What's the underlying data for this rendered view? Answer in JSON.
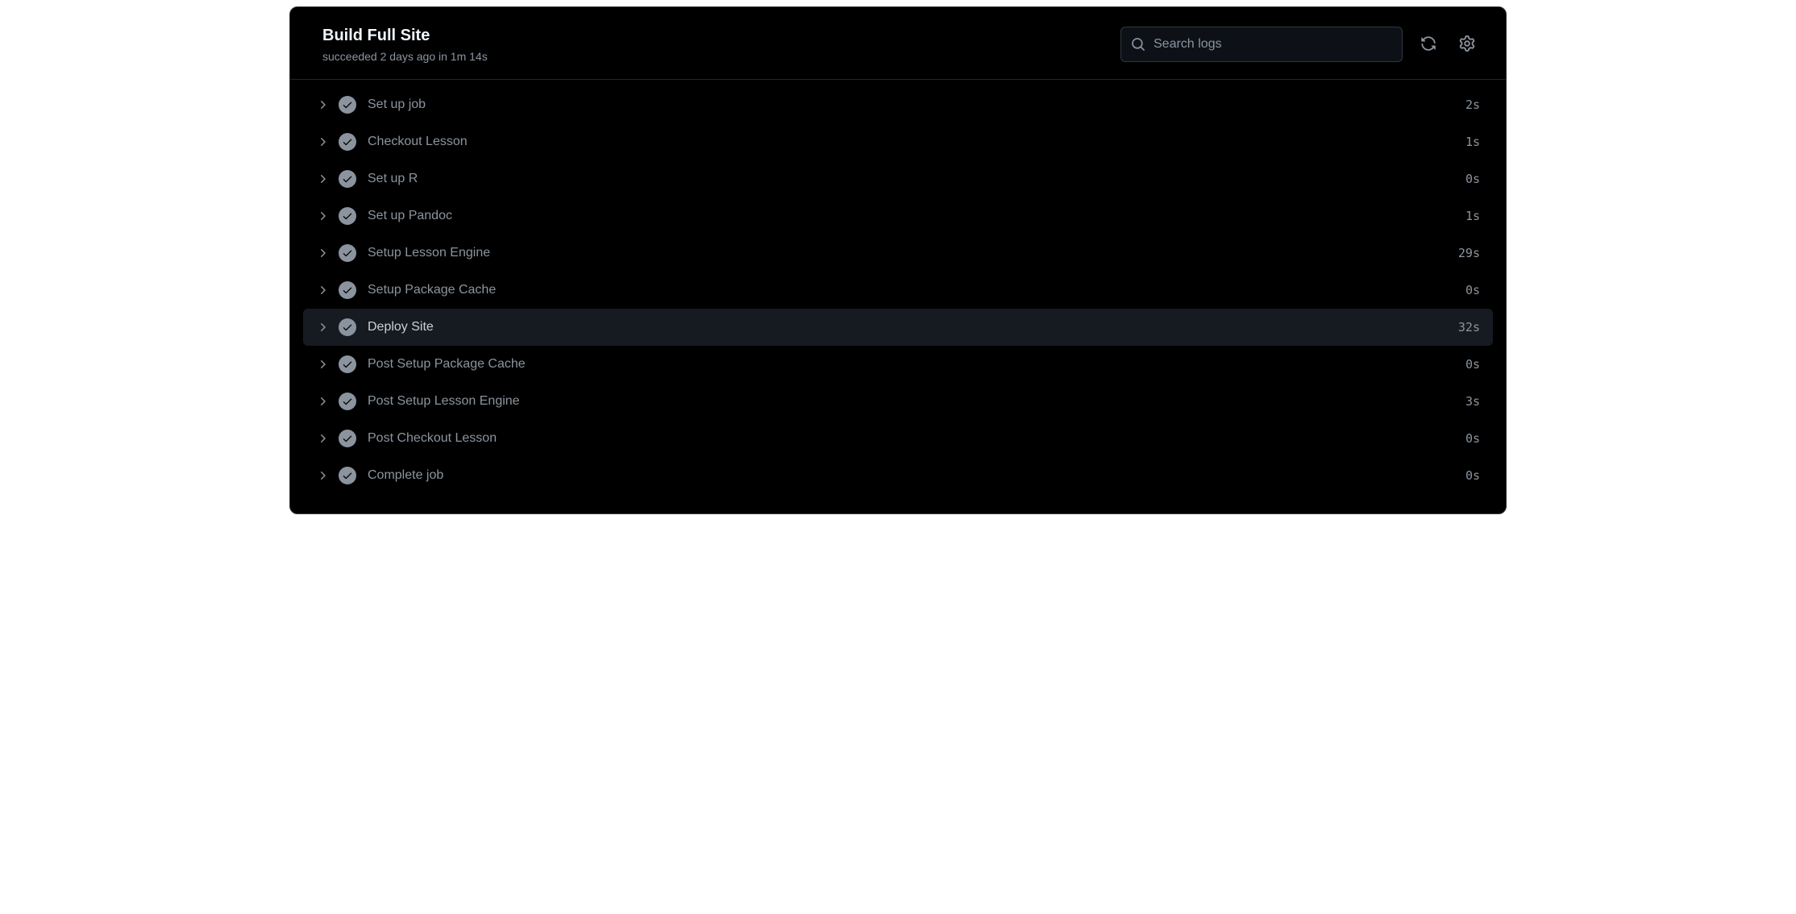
{
  "header": {
    "title": "Build Full Site",
    "subtitle": "succeeded 2 days ago in 1m 14s"
  },
  "search": {
    "placeholder": "Search logs",
    "value": ""
  },
  "steps": [
    {
      "label": "Set up job",
      "duration": "2s"
    },
    {
      "label": "Checkout Lesson",
      "duration": "1s"
    },
    {
      "label": "Set up R",
      "duration": "0s"
    },
    {
      "label": "Set up Pandoc",
      "duration": "1s"
    },
    {
      "label": "Setup Lesson Engine",
      "duration": "29s"
    },
    {
      "label": "Setup Package Cache",
      "duration": "0s"
    },
    {
      "label": "Deploy Site",
      "duration": "32s"
    },
    {
      "label": "Post Setup Package Cache",
      "duration": "0s"
    },
    {
      "label": "Post Setup Lesson Engine",
      "duration": "3s"
    },
    {
      "label": "Post Checkout Lesson",
      "duration": "0s"
    },
    {
      "label": "Complete job",
      "duration": "0s"
    }
  ],
  "activeStepIndex": 6
}
